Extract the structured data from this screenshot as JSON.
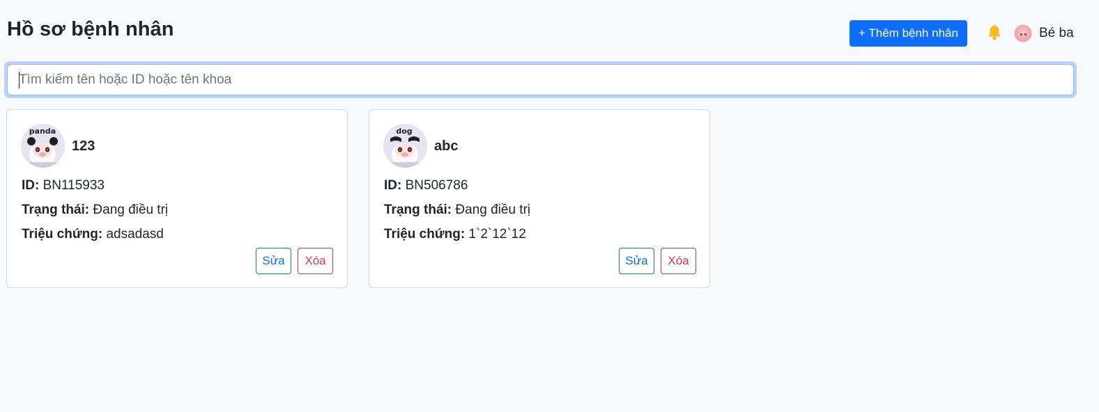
{
  "header": {
    "title": "Hồ sơ bệnh nhân",
    "add_button_label": "+ Thêm bệnh nhân",
    "notification_icon": "bell-icon",
    "user_name": "Bé ba"
  },
  "search": {
    "placeholder": "Tìm kiếm tên hoặc ID hoặc tên khoa",
    "value": ""
  },
  "labels": {
    "id": "ID:",
    "status": "Trạng thái:",
    "symptom": "Triệu chứng:",
    "edit": "Sửa",
    "delete": "Xóa"
  },
  "patients": [
    {
      "name": "123",
      "avatar_caption": "panda",
      "id": "BN115933",
      "status": "Đang điều trị",
      "symptom": "adsadasd"
    },
    {
      "name": "abc",
      "avatar_caption": "dog",
      "id": "BN506786",
      "status": "Đang điều trị",
      "symptom": "1`2`12`12"
    }
  ],
  "colors": {
    "primary": "#0d6efd",
    "danger": "#dc3545",
    "bell": "#f5b921",
    "background": "#f8f9fa"
  }
}
